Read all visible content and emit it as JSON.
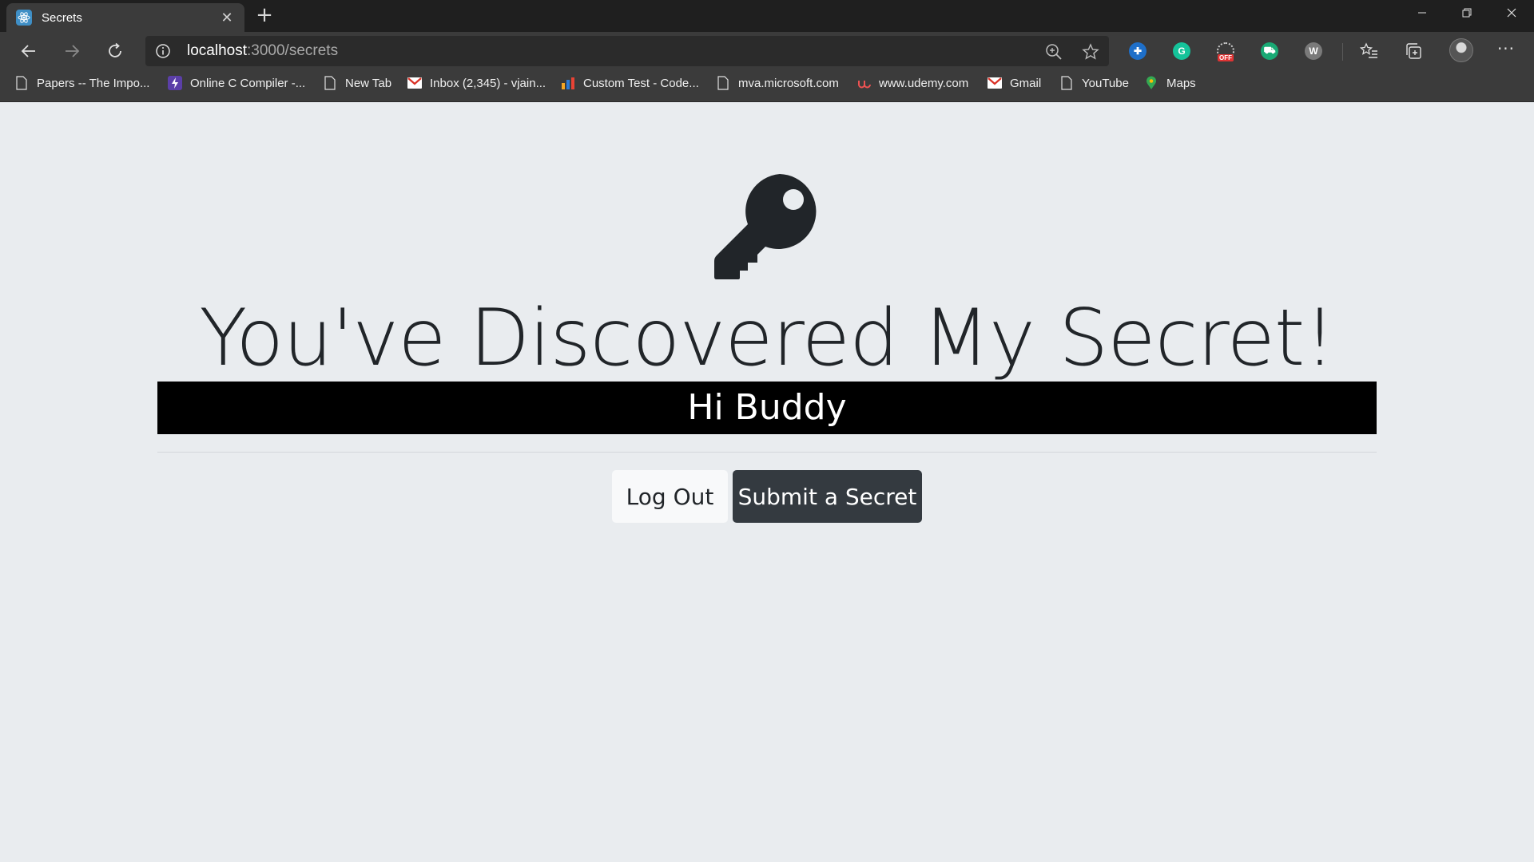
{
  "browser": {
    "tab": {
      "title": "Secrets",
      "close_glyph": "✕"
    },
    "new_tab_glyph": "+",
    "address": {
      "host": "localhost",
      "path": ":3000/secrets"
    },
    "more_glyph": "···",
    "extensions": [
      {
        "name": "shield-extension-icon",
        "color": "#1e6fc9"
      },
      {
        "name": "grammarly-icon",
        "color": "#15c39a",
        "label": "G"
      },
      {
        "name": "off-extension-icon",
        "color": "#e03434",
        "label": "OFF"
      },
      {
        "name": "shop-extension-icon",
        "color": "#19a974"
      },
      {
        "name": "w-extension-icon",
        "color": "#7a7a7a",
        "label": "W"
      }
    ]
  },
  "bookmarks": [
    {
      "label": "Papers -- The Impo...",
      "icon": "page-icon"
    },
    {
      "label": "Online C Compiler -...",
      "icon": "bolt-icon"
    },
    {
      "label": "New Tab",
      "icon": "page-icon"
    },
    {
      "label": "Inbox (2,345) - vjain...",
      "icon": "gmail-icon"
    },
    {
      "label": "Custom Test - Code...",
      "icon": "bar-icon"
    },
    {
      "label": "mva.microsoft.com",
      "icon": "page-icon"
    },
    {
      "label": "www.udemy.com",
      "icon": "udemy-icon"
    },
    {
      "label": "Gmail",
      "icon": "gmail-icon"
    },
    {
      "label": "YouTube",
      "icon": "page-icon"
    },
    {
      "label": "Maps",
      "icon": "maps-icon"
    }
  ],
  "page": {
    "heading": "You've Discovered My Secret!",
    "secret": "Hi Buddy",
    "logout_label": "Log Out",
    "submit_label": "Submit a Secret"
  },
  "colors": {
    "page_bg": "#e9ecef",
    "dark_button": "#343a40",
    "light_button": "#f8f9fa",
    "secret_bg": "#000000"
  }
}
